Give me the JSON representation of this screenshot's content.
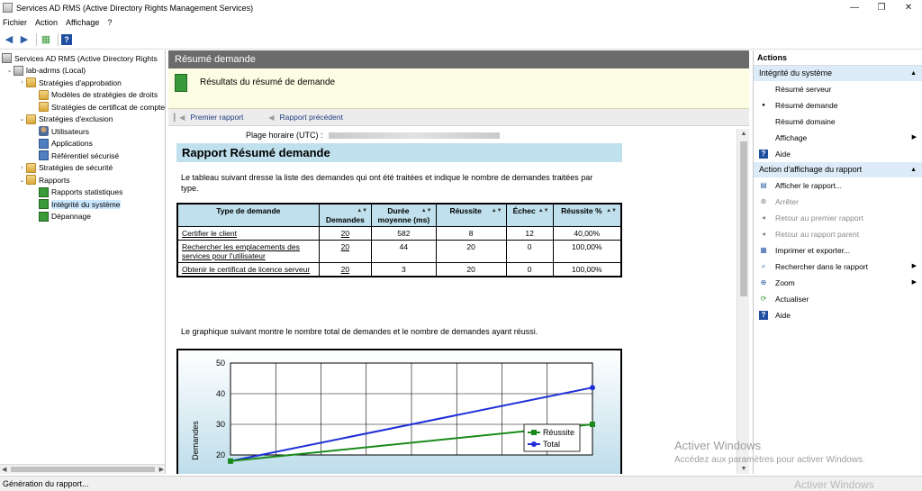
{
  "window": {
    "title": "Services AD RMS (Active Directory Rights Management Services)"
  },
  "menu": [
    "Fichier",
    "Action",
    "Affichage",
    "?"
  ],
  "tree": [
    {
      "label": "Services AD RMS (Active Directory Rights",
      "icon": "server-icon",
      "expander": ""
    },
    {
      "label": "lab-adrms (Local)",
      "icon": "server-icon",
      "expander": "⌄"
    },
    {
      "label": "Stratégies d'approbation",
      "icon": "folder-icon",
      "expander": "›"
    },
    {
      "label": "Modèles de stratégies de droits",
      "icon": "folder-icon",
      "expander": ""
    },
    {
      "label": "Stratégies de certificat de compte",
      "icon": "folder-icon",
      "expander": ""
    },
    {
      "label": "Stratégies d'exclusion",
      "icon": "folder-icon",
      "expander": "⌄"
    },
    {
      "label": "Utilisateurs",
      "icon": "user-icon",
      "expander": ""
    },
    {
      "label": "Applications",
      "icon": "application-icon",
      "expander": ""
    },
    {
      "label": "Référentiel sécurisé",
      "icon": "application-icon",
      "expander": ""
    },
    {
      "label": "Stratégies de sécurité",
      "icon": "folder-icon",
      "expander": "›"
    },
    {
      "label": "Rapports",
      "icon": "folder-icon",
      "expander": "⌄"
    },
    {
      "label": "Rapports statistiques",
      "icon": "report-icon",
      "expander": ""
    },
    {
      "label": "Intégrité du système",
      "icon": "report-icon",
      "expander": ""
    },
    {
      "label": "Dépannage",
      "icon": "report-icon",
      "expander": ""
    }
  ],
  "center": {
    "header": "Résumé demande",
    "result_title": "Résultats du résumé de demande",
    "nav": {
      "first": "Premier rapport",
      "previous": "Rapport précédent"
    },
    "plage_label": "Plage horaire (UTC) :",
    "report_title": "Rapport Résumé demande",
    "description": "Le tableau suivant dresse la liste des demandes qui ont été traitées et indique le nombre de demandes traitées par type.",
    "table_headers": [
      "Type de demande",
      "Demandes",
      "Durée moyenne (ms)",
      "Réussite",
      "Échec",
      "Réussite %"
    ],
    "table_rows": [
      {
        "type": "Certifier le client",
        "demandes": "20",
        "duree": "582",
        "reussite": "8",
        "echec": "12",
        "pct": "40,00%"
      },
      {
        "type": "Rechercher les emplacements des services pour l'utilisateur",
        "demandes": "20",
        "duree": "44",
        "reussite": "20",
        "echec": "0",
        "pct": "100,00%"
      },
      {
        "type": "Obtenir le certificat de licence serveur",
        "demandes": "20",
        "duree": "3",
        "reussite": "20",
        "echec": "0",
        "pct": "100,00%"
      }
    ],
    "chart_description": "Le graphique suivant montre le nombre total de demandes et le nombre de demandes ayant réussi."
  },
  "chart_data": {
    "type": "line",
    "ylabel": "Demandes",
    "ylim": [
      20,
      50
    ],
    "y_ticks": [
      "50",
      "40",
      "30",
      "20"
    ],
    "legend_placement": "right",
    "grid": true,
    "series": [
      {
        "name": "Réussite",
        "color": "#1a8a1a",
        "values": [
          18,
          30
        ]
      },
      {
        "name": "Total",
        "color": "#1f2fd8",
        "values": [
          18,
          42
        ]
      }
    ]
  },
  "actions": {
    "title": "Actions",
    "section1": "Intégrité du système",
    "section1_items": [
      {
        "label": "Résumé serveur",
        "icon": ""
      },
      {
        "label": "Résumé demande",
        "icon": "bullet-icon"
      },
      {
        "label": "Résumé domaine",
        "icon": ""
      },
      {
        "label": "Affichage",
        "icon": "",
        "submenu": true
      },
      {
        "label": "Aide",
        "icon": "help-icon"
      }
    ],
    "section2": "Action d'affichage du rapport",
    "section2_items": [
      {
        "label": "Afficher le rapport...",
        "icon": "view-report-icon"
      },
      {
        "label": "Arrêter",
        "icon": "stop-icon",
        "disabled": true
      },
      {
        "label": "Retour au premier rapport",
        "icon": "first-report-icon",
        "disabled": true
      },
      {
        "label": "Retour au rapport parent",
        "icon": "parent-report-icon",
        "disabled": true
      },
      {
        "label": "Imprimer et exporter...",
        "icon": "print-icon"
      },
      {
        "label": "Rechercher dans le rapport",
        "icon": "search-icon",
        "submenu": true
      },
      {
        "label": "Zoom",
        "icon": "zoom-icon",
        "submenu": true
      },
      {
        "label": "Actualiser",
        "icon": "refresh-icon"
      },
      {
        "label": "Aide",
        "icon": "help-icon"
      }
    ]
  },
  "status": "Génération du rapport...",
  "watermark": {
    "line1": "Activer Windows",
    "line2": "Accédez aux paramètres pour activer Windows.",
    "line3": "Activer Windows"
  }
}
